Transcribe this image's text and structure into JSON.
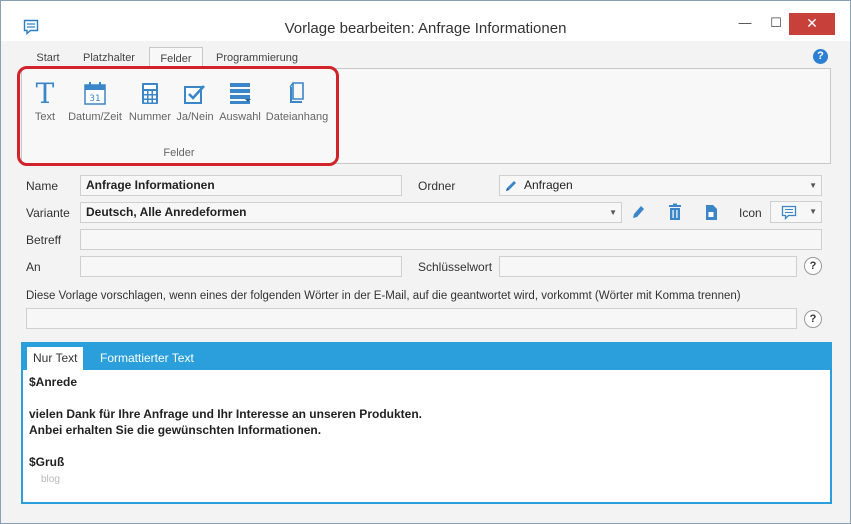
{
  "window": {
    "title": "Vorlage bearbeiten: Anfrage Informationen",
    "minimize_glyph": "—",
    "maximize_glyph": "☐",
    "close_glyph": "✕"
  },
  "ribbon": {
    "tabs": [
      {
        "label": "Start"
      },
      {
        "label": "Platzhalter"
      },
      {
        "label": "Felder"
      },
      {
        "label": "Programmierung"
      }
    ],
    "active_tab": "Felder",
    "help_glyph": "?",
    "buttons": [
      {
        "label": "Text",
        "icon": "text-icon"
      },
      {
        "label": "Datum/Zeit",
        "icon": "calendar-icon"
      },
      {
        "label": "Nummer",
        "icon": "calculator-icon"
      },
      {
        "label": "Ja/Nein",
        "icon": "checkbox-icon"
      },
      {
        "label": "Auswahl",
        "icon": "list-icon"
      },
      {
        "label": "Dateianhang",
        "icon": "attachment-icon"
      }
    ],
    "calendar_day": "31",
    "group_label": "Felder"
  },
  "form": {
    "name_label": "Name",
    "name_value": "Anfrage Informationen",
    "folder_label": "Ordner",
    "folder_value": "Anfragen",
    "variant_label": "Variante",
    "variant_value": "Deutsch, Alle Anredeformen",
    "icon_label": "Icon",
    "subject_label": "Betreff",
    "subject_value": "",
    "to_label": "An",
    "to_value": "",
    "keyword_label": "Schlüsselwort",
    "keyword_value": "",
    "suggest_text": "Diese Vorlage vorschlagen, wenn eines der folgenden Wörter in der E-Mail, auf die geantwortet wird, vorkommt (Wörter mit Komma trennen)",
    "suggest_value": "",
    "help_glyph": "?"
  },
  "editor": {
    "tabs": [
      {
        "label": "Nur Text"
      },
      {
        "label": "Formattierter Text"
      }
    ],
    "lines": [
      "$Anrede",
      "",
      "vielen Dank für Ihre Anfrage und Ihr Interesse an unseren Produkten.",
      "Anbei erhalten Sie die gewünschten Informationen.",
      "",
      "$Gruß"
    ],
    "watermark": "blog"
  },
  "colors": {
    "accent": "#2a9fdc",
    "highlight": "#d2232a",
    "close": "#c7403a",
    "icon_blue": "#3a86c8"
  }
}
